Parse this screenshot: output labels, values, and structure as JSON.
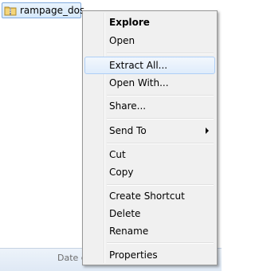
{
  "file": {
    "name": "rampage_dos"
  },
  "status_bar": {
    "text": "Date c"
  },
  "context_menu": {
    "explore": "Explore",
    "open": "Open",
    "extract_all": "Extract All...",
    "open_with": "Open With...",
    "share": "Share...",
    "send_to": "Send To",
    "cut": "Cut",
    "copy": "Copy",
    "create_shortcut": "Create Shortcut",
    "delete": "Delete",
    "rename": "Rename",
    "properties": "Properties"
  },
  "icons": {
    "file": "zip-folder-icon",
    "submenu": "submenu-arrow-icon"
  },
  "colors": {
    "selection_border": "#84acdd",
    "menu_background": "#f0f0f0",
    "hover_border": "#aecff7"
  }
}
